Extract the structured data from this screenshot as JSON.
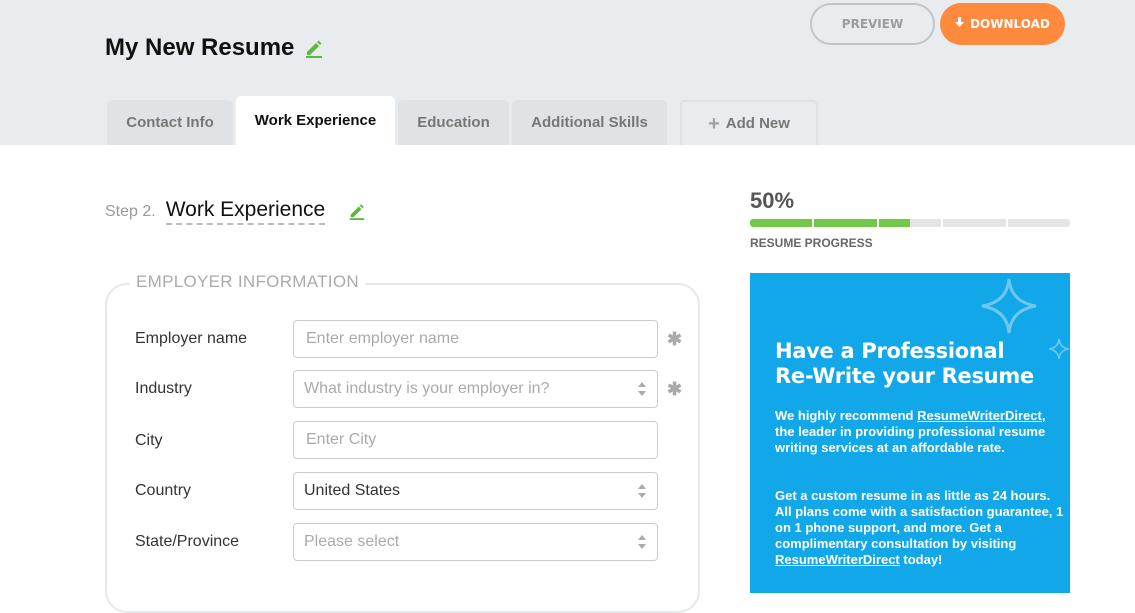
{
  "header": {
    "title": "My New Resume",
    "preview_label": "PREVIEW",
    "download_label": "DOWNLOAD"
  },
  "tabs": [
    {
      "label": "Contact Info",
      "active": false
    },
    {
      "label": "Work Experience",
      "active": true
    },
    {
      "label": "Education",
      "active": false
    },
    {
      "label": "Additional Skills",
      "active": false
    }
  ],
  "add_new_label": "Add New",
  "step": {
    "label": "Step 2.",
    "title": "Work Experience"
  },
  "form": {
    "legend": "EMPLOYER INFORMATION",
    "fields": [
      {
        "label": "Employer name",
        "placeholder": "Enter employer name",
        "value": "",
        "type": "text",
        "required": true
      },
      {
        "label": "Industry",
        "placeholder": "What industry is your employer in?",
        "value": "",
        "type": "select",
        "required": true
      },
      {
        "label": "City",
        "placeholder": "Enter City",
        "value": "",
        "type": "text",
        "required": false
      },
      {
        "label": "Country",
        "placeholder": "",
        "value": "United States",
        "type": "select",
        "required": false
      },
      {
        "label": "State/Province",
        "placeholder": "Please select",
        "value": "",
        "type": "select",
        "required": false
      }
    ],
    "required_marker": "✱"
  },
  "progress": {
    "percent_label": "50%",
    "value": 0.5,
    "segments_total": 5,
    "label": "RESUME PROGRESS"
  },
  "promo": {
    "title_line1": "Have a Professional",
    "title_line2": "Re-Write your Resume",
    "p1_before": "We highly recommend ",
    "p1_link": "ResumeWriterDirect",
    "p1_after": ", the leader in providing professional resume writing services at an affordable rate.",
    "p2_before": "Get a custom resume in as little as 24 hours. All plans come with a satisfaction guarantee, 1 on 1 phone support, and more. Get a complimentary consultation by visiting ",
    "p2_link": "ResumeWriterDirect",
    "p2_after": " today!"
  },
  "colors": {
    "accent_green": "#72c84b",
    "download_orange": "#ff8a3d",
    "promo_blue": "#12a7e8"
  }
}
